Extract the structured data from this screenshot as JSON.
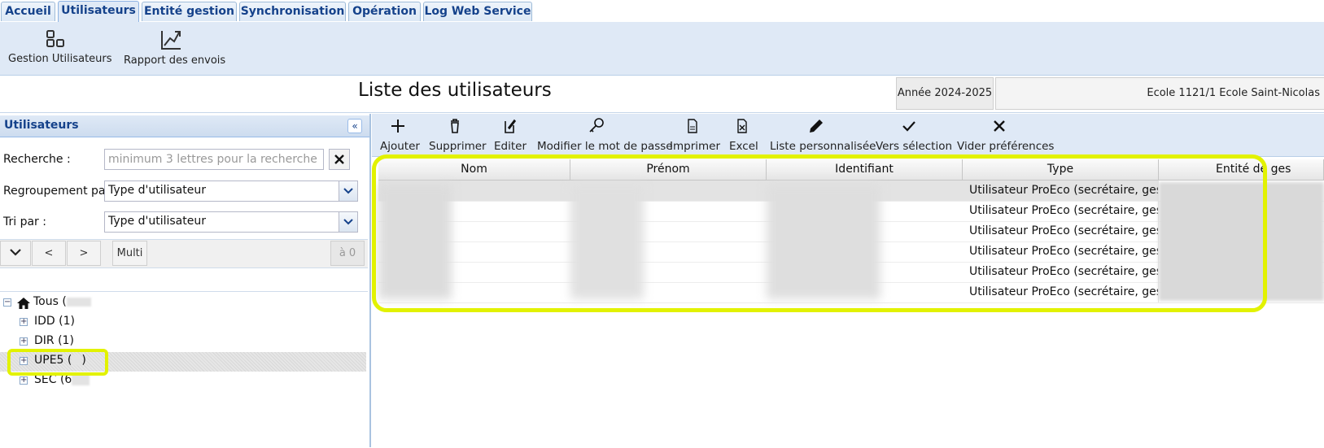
{
  "tabs": [
    {
      "label": "Accueil",
      "active": false
    },
    {
      "label": "Utilisateurs",
      "active": true
    },
    {
      "label": "Entité gestion",
      "active": false
    },
    {
      "label": "Synchronisation",
      "active": false
    },
    {
      "label": "Opération",
      "active": false
    },
    {
      "label": "Log Web Service",
      "active": false
    }
  ],
  "ribbon": {
    "gestion_label": "Gestion Utilisateurs",
    "rapport_label": "Rapport des envois"
  },
  "header": {
    "title": "Liste des utilisateurs",
    "year": "Année 2024-2025",
    "school": "Ecole 1121/1 Ecole Saint-Nicolas"
  },
  "left_panel": {
    "title": "Utilisateurs",
    "search_label": "Recherche :",
    "search_placeholder": "minimum 3 lettres pour la recherche",
    "search_value": "",
    "group_label": "Regroupement par :",
    "group_value": "Type d'utilisateur",
    "sort_label": "Tri par :",
    "sort_value": "Type d'utilisateur",
    "nav": {
      "prev": "<",
      "next": ">",
      "multi": "Multi",
      "count": "à 0"
    },
    "tree": [
      {
        "label": "Tous (",
        "suffix": "",
        "expanded": true
      },
      {
        "label": "IDD (1)",
        "suffix": "",
        "expanded": false
      },
      {
        "label": "DIR (1)",
        "suffix": "",
        "expanded": false
      },
      {
        "label": "UPE5 (",
        "suffix": ")",
        "expanded": false,
        "selected": true
      },
      {
        "label": "SEC (6",
        "suffix": "",
        "expanded": false
      }
    ]
  },
  "toolbar": {
    "ajouter": "Ajouter",
    "supprimer": "Supprimer",
    "editer": "Editer",
    "modifier_mdp": "Modifier le mot de passe",
    "imprimer": "Imprimer",
    "excel": "Excel",
    "liste_perso": "Liste personnalisée",
    "vers_selection": "Vers sélection",
    "vider_prefs": "Vider préférences"
  },
  "grid": {
    "columns": [
      "Nom",
      "Prénom",
      "Identifiant",
      "Type",
      "Entité de ges"
    ],
    "rows": [
      {
        "type": "Utilisateur ProEco (secrétaire, gestio..."
      },
      {
        "type": "Utilisateur ProEco (secrétaire, gestio..."
      },
      {
        "type": "Utilisateur ProEco (secrétaire, gestio..."
      },
      {
        "type": "Utilisateur ProEco (secrétaire, gestio..."
      },
      {
        "type": "Utilisateur ProEco (secrétaire, gestio..."
      },
      {
        "type": "Utilisateur ProEco (secrétaire, gestio..."
      }
    ]
  },
  "colors": {
    "highlight": "#e2f200",
    "tab_text": "#15428b",
    "ribbon_bg": "#dfe9f6"
  }
}
